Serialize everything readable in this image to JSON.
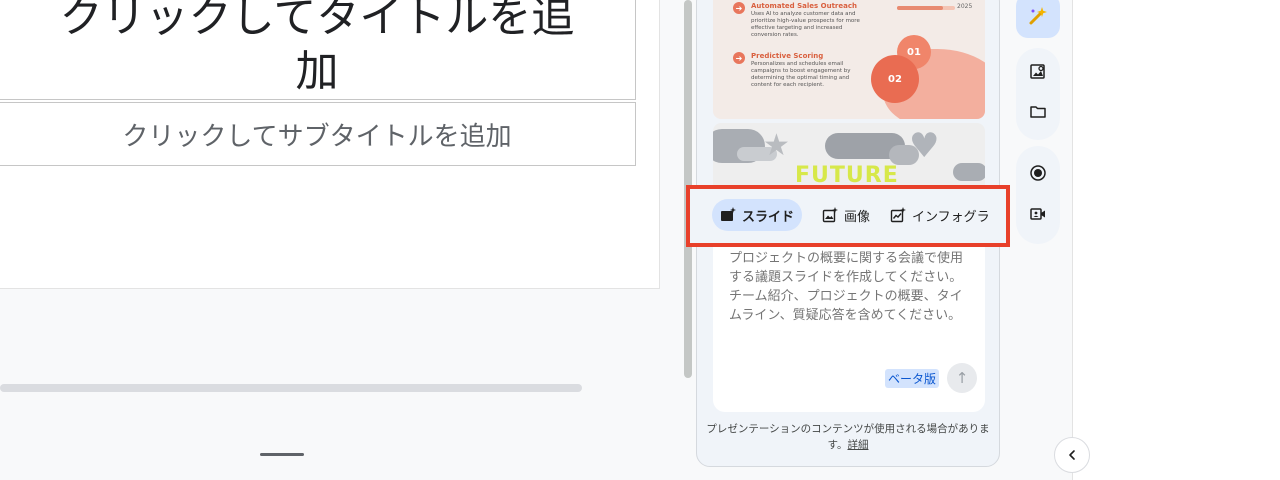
{
  "slide": {
    "title_line1": "クリックしてタイトルを追",
    "title_line2": "加",
    "subtitle": "クリックしてサブタイトルを追加"
  },
  "thumbnail_marketing": {
    "item1_title": "Automated Sales Outreach",
    "item1_body": "Uses AI to analyze customer data and prioritize high-value prospects for more effective targeting and increased conversion rates.",
    "item2_title": "Predictive Scoring",
    "item2_body": "Personalizes and schedules email campaigns to boost engagement by determining the optimal timing and content for each recipient.",
    "year": "2025",
    "bubble1": "01",
    "bubble2": "02"
  },
  "thumbnail_future": {
    "headline": "FUTURE"
  },
  "tools": {
    "slide_label": "スライド",
    "image_label": "画像",
    "infographic_label": "インフォグラ",
    "active": "slide"
  },
  "prompt": {
    "placeholder": "プロジェクトの概要に関する会議で使用する議題スライドを作成してください。チーム紹介、プロジェクトの概要、タイムライン、質疑応答を含めてください。",
    "beta_label": "ベータ版"
  },
  "disclaimer": {
    "text": "プレゼンテーションのコンテンツが使用される場合がありま す。",
    "link": "詳細"
  },
  "rail": {
    "icons": [
      "gemini-sparkle-icon",
      "image-search-icon",
      "folder-icon",
      "record-icon",
      "video-call-icon"
    ]
  },
  "colors": {
    "accent_blue": "#d3e3fd",
    "highlight_red": "#e8402a",
    "marketing_orange": "#e8765c",
    "future_yellow": "#d7e84a"
  }
}
